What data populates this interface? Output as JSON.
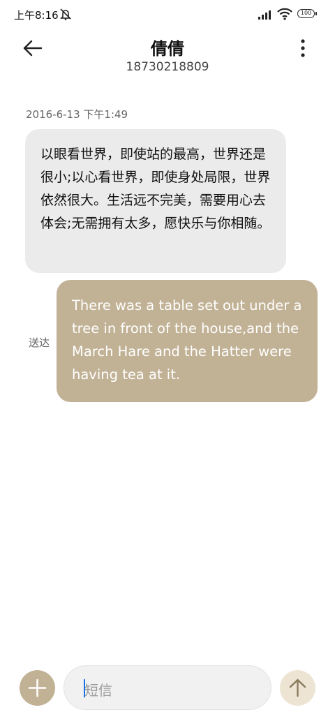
{
  "status_bar": {
    "time": "上午8:16",
    "battery_level": "100",
    "icons": [
      "mute-icon",
      "signal-icon",
      "wifi-icon",
      "battery-icon"
    ]
  },
  "header": {
    "back_icon": "arrow-left-icon",
    "contact_name": "倩倩",
    "contact_number": "18730218809",
    "more_icon": "more-vertical-icon"
  },
  "conversation": {
    "timestamp": "2016-6-13 下午1:49",
    "messages": [
      {
        "direction": "received",
        "text": "以眼看世界，即使站的最高，世界还是很小;以心看世界，即使身处局限，世界依然很大。生活远不完美，需要用心去体会;无需拥有太多，愿快乐与你相随。"
      },
      {
        "direction": "sent",
        "status": "送达",
        "text": "There was a table set out under a tree in front of the house,and the March Hare and the Hatter were having tea at it."
      }
    ]
  },
  "composer": {
    "attach_icon": "plus-icon",
    "placeholder": "短信",
    "send_icon": "arrow-up-icon"
  },
  "colors": {
    "accent": "#c1b195",
    "received_bubble": "#ebebeb",
    "send_button_bg": "#ede4d3",
    "caret": "#1a73e8"
  }
}
